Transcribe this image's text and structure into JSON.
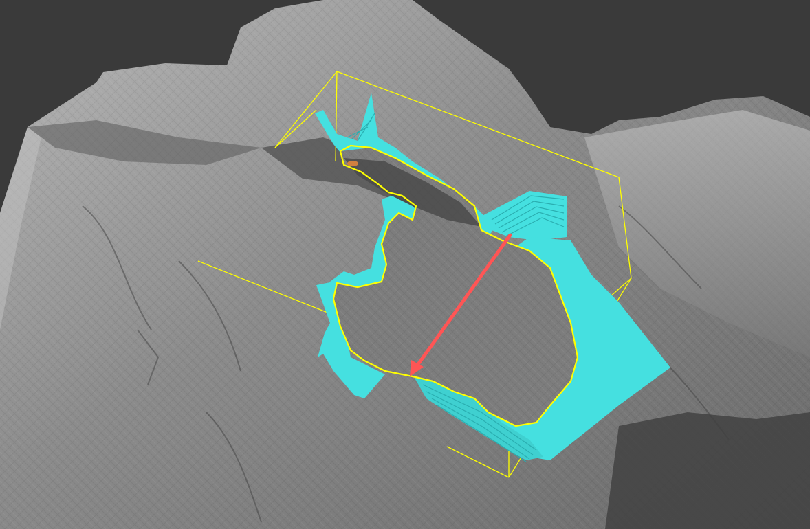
{
  "viewer": {
    "background_color": "#3a3a3a",
    "terrain_color": "#9a9a9a",
    "region_fill_color": "#45e0e0",
    "boundary_color": "#ffff00",
    "bounding_box_color": "#ffff00",
    "direction_arrow_color": "#ff5555"
  },
  "icons": {
    "terrain": "terrain-mesh",
    "region": "landslide-region",
    "arrow": "direction-arrow"
  }
}
